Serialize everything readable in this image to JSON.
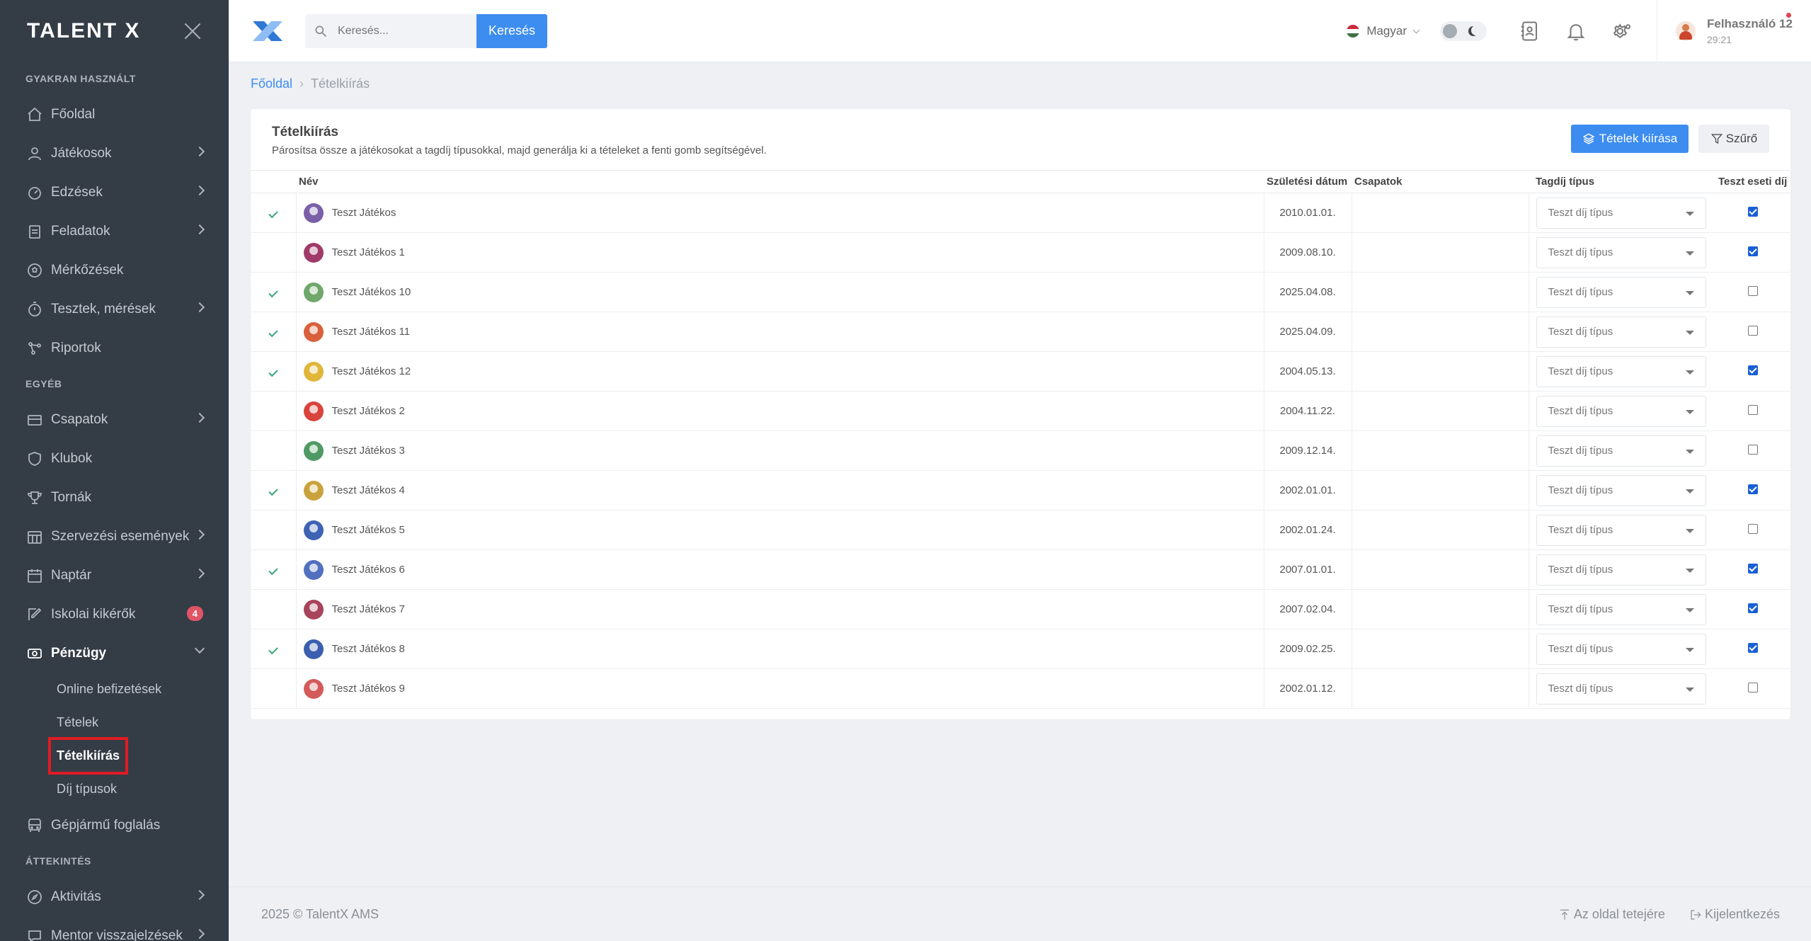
{
  "brand": {
    "logo": "TALENT X"
  },
  "sidebar": {
    "sections": [
      {
        "title": "GYAKRAN HASZNÁLT",
        "items": [
          {
            "label": "Főoldal",
            "icon": "home-icon",
            "chevron": false
          },
          {
            "label": "Játékosok",
            "icon": "user-icon",
            "chevron": true
          },
          {
            "label": "Edzések",
            "icon": "gauge-icon",
            "chevron": true
          },
          {
            "label": "Feladatok",
            "icon": "clipboard-icon",
            "chevron": true
          },
          {
            "label": "Mérkőzések",
            "icon": "ball-icon",
            "chevron": false
          },
          {
            "label": "Tesztek, mérések",
            "icon": "stopwatch-icon",
            "chevron": true
          },
          {
            "label": "Riportok",
            "icon": "nodes-icon",
            "chevron": false
          }
        ]
      },
      {
        "title": "EGYÉB",
        "items": [
          {
            "label": "Csapatok",
            "icon": "team-icon",
            "chevron": true
          },
          {
            "label": "Klubok",
            "icon": "shield-icon",
            "chevron": false
          },
          {
            "label": "Tornák",
            "icon": "trophy-icon",
            "chevron": false
          },
          {
            "label": "Szervezési események",
            "icon": "calendar-grid-icon",
            "chevron": true
          },
          {
            "label": "Naptár",
            "icon": "calendar-icon",
            "chevron": true
          },
          {
            "label": "Iskolai kikérők",
            "icon": "edit-icon",
            "badge": "4"
          },
          {
            "label": "Pénzügy",
            "icon": "money-icon",
            "expanded": true
          }
        ]
      }
    ],
    "finance_sub": [
      "Online befizetések",
      "Tételek",
      "Tételkiírás",
      "Díj típusok"
    ],
    "after_finance": {
      "label": "Gépjármű foglalás",
      "icon": "bus-icon"
    },
    "section3_title": "ÁTTEKINTÉS",
    "section3_items": [
      {
        "label": "Aktivitás",
        "icon": "compass-icon"
      },
      {
        "label": "Mentor visszajelzések",
        "icon": "chat-icon"
      }
    ]
  },
  "header": {
    "search_placeholder": "Keresés...",
    "search_button": "Keresés",
    "language": "Magyar",
    "user_name": "Felhasználó 12",
    "user_time": "29:21"
  },
  "breadcrumb": {
    "home": "Főoldal",
    "current": "Tételkiírás"
  },
  "card": {
    "title": "Tételkiírás",
    "subtitle": "Párosítsa össze a játékosokat a tagdíj típusokkal, majd generálja ki a tételeket a fenti gomb segítségével.",
    "primary_button": "Tételek kiírása",
    "filter_button": "Szűrő"
  },
  "table": {
    "columns": [
      "Név",
      "Születési dátum",
      "Csapatok",
      "Tagdíj típus",
      "Teszt eseti díj"
    ],
    "type_value": "Teszt díj típus",
    "rows": [
      {
        "checked": true,
        "name": "Teszt Játékos",
        "dob": "2010.01.01.",
        "team": "",
        "fee": true,
        "color": "#7a5fa8"
      },
      {
        "checked": false,
        "name": "Teszt Játékos 1",
        "dob": "2009.08.10.",
        "team": "",
        "fee": true,
        "color": "#a03a6a"
      },
      {
        "checked": true,
        "name": "Teszt Játékos 10",
        "dob": "2025.04.08.",
        "team": "",
        "fee": false,
        "color": "#6fa86a"
      },
      {
        "checked": true,
        "name": "Teszt Játékos 11",
        "dob": "2025.04.09.",
        "team": "",
        "fee": false,
        "color": "#d9603a"
      },
      {
        "checked": true,
        "name": "Teszt Játékos 12",
        "dob": "2004.05.13.",
        "team": "",
        "fee": true,
        "color": "#e0b63a"
      },
      {
        "checked": false,
        "name": "Teszt Játékos 2",
        "dob": "2004.11.22.",
        "team": "",
        "fee": false,
        "color": "#d8433c"
      },
      {
        "checked": false,
        "name": "Teszt Játékos 3",
        "dob": "2009.12.14.",
        "team": "",
        "fee": false,
        "color": "#4f9a64"
      },
      {
        "checked": true,
        "name": "Teszt Játékos 4",
        "dob": "2002.01.01.",
        "team": "",
        "fee": true,
        "color": "#c9a23c"
      },
      {
        "checked": false,
        "name": "Teszt Játékos 5",
        "dob": "2002.01.24.",
        "team": "",
        "fee": false,
        "color": "#3e63b5"
      },
      {
        "checked": true,
        "name": "Teszt Játékos 6",
        "dob": "2007.01.01.",
        "team": "",
        "fee": true,
        "color": "#5270c0"
      },
      {
        "checked": false,
        "name": "Teszt Játékos 7",
        "dob": "2007.02.04.",
        "team": "",
        "fee": true,
        "color": "#a8445c"
      },
      {
        "checked": true,
        "name": "Teszt Játékos 8",
        "dob": "2009.02.25.",
        "team": "",
        "fee": true,
        "color": "#3b5fae"
      },
      {
        "checked": false,
        "name": "Teszt Játékos 9",
        "dob": "2002.01.12.",
        "team": "",
        "fee": false,
        "color": "#d45a5a"
      }
    ]
  },
  "footer": {
    "copyright": "2025 © TalentX AMS",
    "to_top": "Az oldal tetejére",
    "logout": "Kijelentkezés"
  },
  "colors": {
    "accent": "#3d8df0",
    "sidebar_bg": "#343c46",
    "highlight_box": "#e01b24",
    "check_green": "#3aa77a"
  }
}
